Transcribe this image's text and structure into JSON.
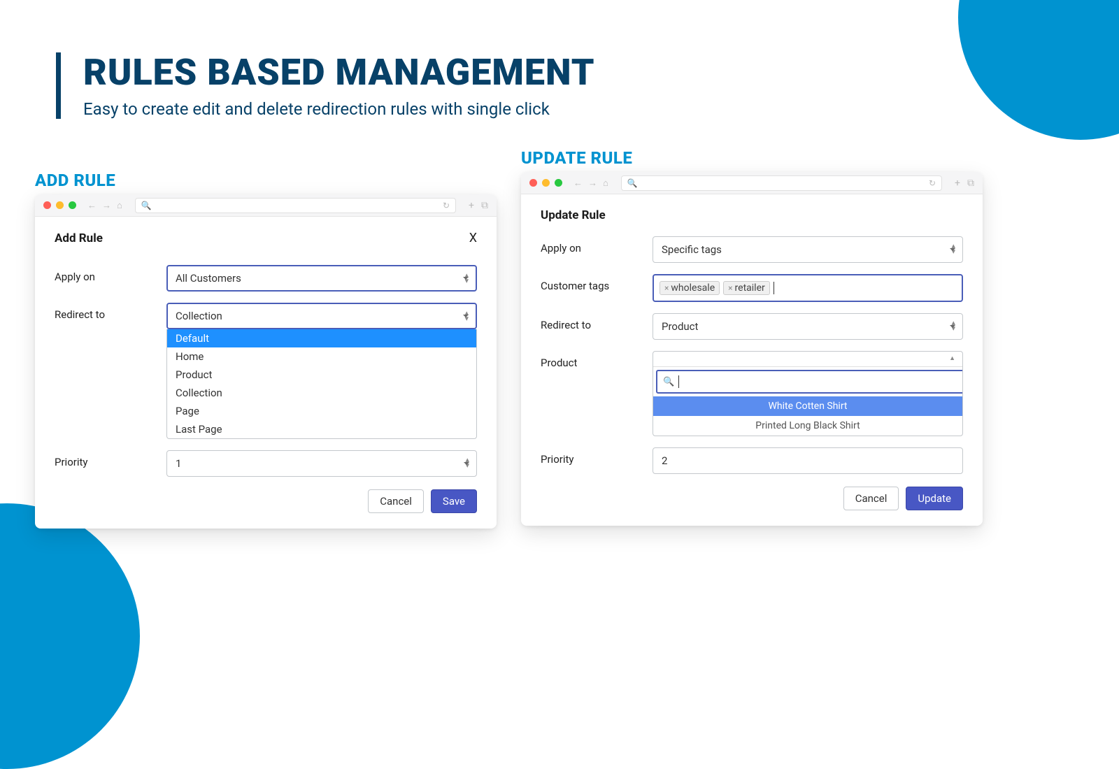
{
  "heading": {
    "title": "RULES BASED MANAGEMENT",
    "subtitle": "Easy to create edit and delete redirection rules with single click"
  },
  "sections": {
    "add_label": "ADD RULE",
    "update_label": "UPDATE RULE"
  },
  "add": {
    "title": "Add Rule",
    "apply_on": {
      "label": "Apply on",
      "value": "All Customers"
    },
    "redirect": {
      "label": "Redirect to",
      "value": "Collection",
      "options": [
        "Default",
        "Home",
        "Product",
        "Collection",
        "Page",
        "Last Page"
      ],
      "highlighted": "Default"
    },
    "priority": {
      "label": "Priority",
      "value": "1"
    },
    "buttons": {
      "cancel": "Cancel",
      "save": "Save"
    }
  },
  "update": {
    "title": "Update Rule",
    "apply_on": {
      "label": "Apply on",
      "value": "Specific tags"
    },
    "customer_tags": {
      "label": "Customer tags",
      "tags": [
        "wholesale",
        "retailer"
      ]
    },
    "redirect": {
      "label": "Redirect to",
      "value": "Product"
    },
    "product": {
      "label": "Product",
      "search": "",
      "options": [
        "White Cotten Shirt",
        "Printed Long Black Shirt"
      ],
      "highlighted": "White Cotten Shirt"
    },
    "priority": {
      "label": "Priority",
      "value": "2"
    },
    "buttons": {
      "cancel": "Cancel",
      "update": "Update"
    }
  }
}
